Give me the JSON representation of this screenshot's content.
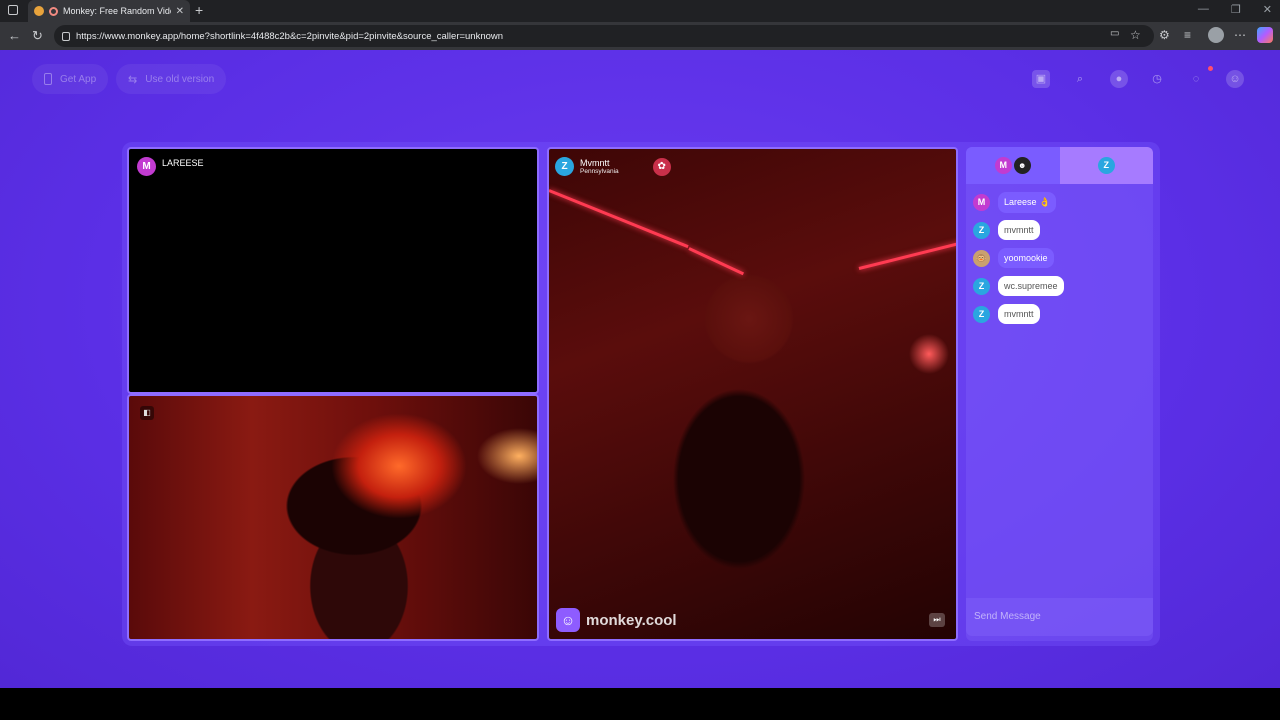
{
  "browser": {
    "tab_title": "Monkey: Free Random Video",
    "tab_close": "✕",
    "new_tab": "+",
    "url": "https://www.monkey.app/home?shortlink=4f488c2b&c=2pinvite&pid=2pinvite&source_caller=unknown",
    "window_buttons": [
      "—",
      "❐",
      "✕"
    ]
  },
  "header": {
    "get_app_label": "Get App",
    "old_version_label": "Use old version"
  },
  "tiles": {
    "top_left": {
      "avatar_letter": "M",
      "name": "LAREESE"
    },
    "right": {
      "avatar_letter": "Z",
      "name": "Mvmntt",
      "location": "Pennsylvania"
    }
  },
  "watermark": {
    "text": "monkey.cool"
  },
  "chat": {
    "tab1_letter": "M",
    "tab2_letter": "Z",
    "messages": [
      {
        "avatar": "M",
        "text": "Lareese 👌",
        "style": "purple"
      },
      {
        "avatar": "Z",
        "text": "mvmntt",
        "style": "white"
      },
      {
        "avatar": "🐵",
        "text": "yoomookie",
        "style": "purple"
      },
      {
        "avatar": "Z",
        "text": "wc.supremee",
        "style": "white"
      },
      {
        "avatar": "Z",
        "text": "mvmntt",
        "style": "white"
      }
    ],
    "send_placeholder": "Send Message"
  },
  "colors": {
    "page_bg": "#5b2fe6",
    "accent": "#7b5cff"
  }
}
